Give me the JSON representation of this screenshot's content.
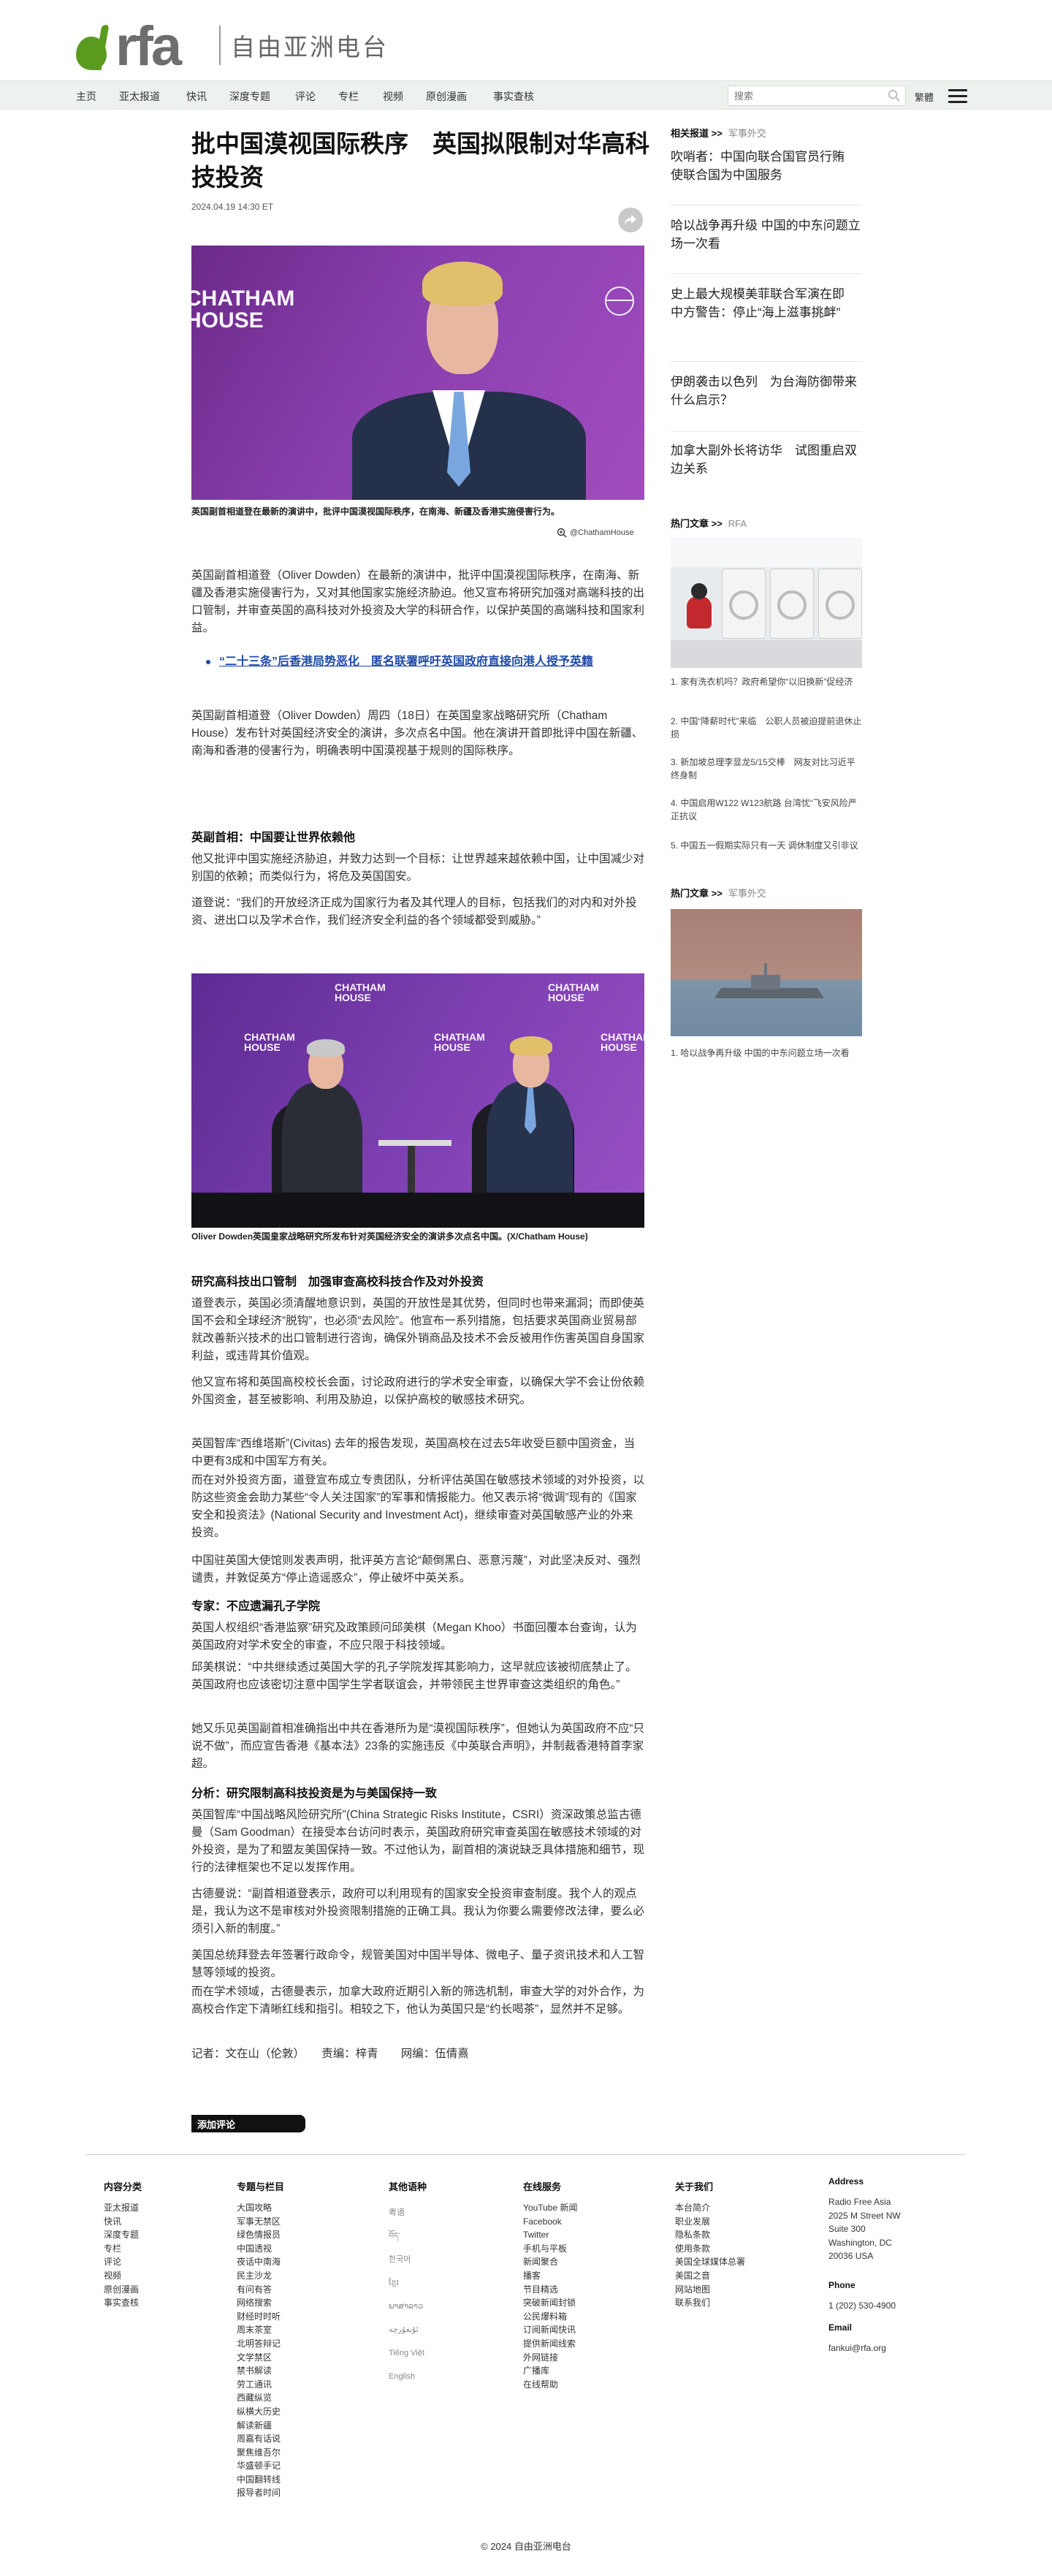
{
  "header": {
    "logo_text": "rfa",
    "logo_cn": "自由亚洲电台"
  },
  "nav": {
    "items": [
      "主页",
      "亚太报道",
      "快讯",
      "深度专题",
      "评论",
      "专栏",
      "视频",
      "原创漫画",
      "事实查核"
    ],
    "search_placeholder": "搜索",
    "lang": "繁體"
  },
  "article": {
    "title": "批中国漠视国际秩序　英国拟限制对华高科技投资",
    "date": "2024.04.19 14:30 ET",
    "photo1_caption": "英国副首相道登在最新的演讲中，批评中国漠视国际秩序，在南海、新疆及香港实施侵害行为。",
    "photo1_credit": "@ChathamHouse",
    "photo1_logo_text": "CHATHAM HOUSE",
    "p1": "英国副首相道登（Oliver Dowden）在最新的演讲中，批评中国漠视国际秩序，在南海、新疆及香港实施侵害行为，又对其他国家实施经济胁迫。他又宣布将研究加强对高端科技的出口管制，并审查英国的高科技对外投资及大学的科研合作，以保护英国的高端科技和国家利益。",
    "related_link": "“二十三条”后香港局势恶化　匿名联署呼吁英国政府直接向港人授予英籍",
    "p2": "英国副首相道登（Oliver Dowden）周四（18日）在英国皇家战略研究所（Chatham House）发布针对英国经济安全的演讲，多次点名中国。他在演讲开首即批评中国在新疆、南海和香港的侵害行为，明确表明中国漠视基于规则的国际秩序。",
    "h1": "英副首相：中国要让世界依赖他",
    "p3": "他又批评中国实施经济胁迫，并致力达到一个目标：让世界越来越依赖中国，让中国减少对别国的依赖；而类似行为，将危及英国国安。",
    "p4": "道登说：“我们的开放经济正成为国家行为者及其代理人的目标，包括我们的对内和对外投资、进出口以及学术合作，我们经济安全利益的各个领域都受到威胁。”",
    "photo2_caption": "Oliver Dowden英国皇家战略研究所发布针对英国经济安全的演讲多次点名中国。(X/Chatham House)",
    "photo2_logo_text": "CHATHAM HOUSE",
    "h2": "研究高科技出口管制　加强审查高校科技合作及对外投资",
    "p5": "道登表示，英国必须清醒地意识到，英国的开放性是其优势，但同时也带来漏洞；而即使英国不会和全球经济“脱钩”，也必须“去风险”。他宣布一系列措施，包括要求英国商业贸易部就改善新兴技术的出口管制进行咨询，确保外销商品及技术不会反被用作伤害英国自身国家利益，或违背其价值观。",
    "p6": "他又宣布将和英国高校校长会面，讨论政府进行的学术安全审查，以确保大学不会让份依赖外国资金，甚至被影响、利用及胁迫，以保护高校的敏感技术研究。",
    "p7": "英国智库“西维塔斯”(Civitas) 去年的报告发现，英国高校在过去5年收受巨额中国资金，当中更有3成和中国军方有关。",
    "p8": "而在对外投资方面，道登宣布成立专责团队，分析评估英国在敏感技术领域的对外投资，以防这些资金会助力某些“令人关注国家”的军事和情报能力。他又表示将“微调”现有的《国家安全和投资法》(National Security and Investment Act)，继续审查对英国敏感产业的外来投资。",
    "p9": "中国驻英国大使馆则发表声明，批评英方言论“颠倒黑白、恶意污蔑”，对此坚决反对、强烈谴责，并敦促英方“停止造谣惑众”，停止破坏中英关系。",
    "h3": "专家：不应遗漏孔子学院",
    "p10": "英国人权组织“香港监察”研究及政策顾问邱美棋（Megan Khoo）书面回覆本台查询，认为英国政府对学术安全的审查，不应只限于科技领域。",
    "p11": "邱美棋说：“中共继续透过英国大学的孔子学院发挥其影响力，这早就应该被彻底禁止了。英国政府也应该密切注意中国学生学者联谊会，并带领民主世界审查这类组织的角色。”",
    "p12": "她又乐见英国副首相准确指出中共在香港所为是“漠视国际秩序”，但她认为英国政府不应“只说不做”，而应宣告香港《基本法》23条的实施违反《中英联合声明》，并制裁香港特首李家超。",
    "h4": "分析：研究限制高科技投资是为与美国保持一致",
    "p13": "英国智库“中国战略风险研究所”(China Strategic Risks Institute，CSRI）资深政策总监古德曼（Sam Goodman）在接受本台访问时表示，英国政府研究审查英国在敏感技术领域的对外投资，是为了和盟友美国保持一致。不过他认为，副首相的演说缺乏具体措施和细节，现行的法律框架也不足以发挥作用。",
    "p14": "古德曼说：“副首相道登表示，政府可以利用现有的国家安全投资审查制度。我个人的观点是，我认为这不是审核对外投资限制措施的正确工具。我认为你要么需要修改法律，要么必须引入新的制度。”",
    "p15": "美国总统拜登去年签署行政命令，规管美国对中国半导体、微电子、量子资讯技术和人工智慧等领域的投资。",
    "p16": "而在学术领域，古德曼表示，加拿大政府近期引入新的筛选机制，审查大学的对外合作，为高校合作定下清晰红线和指引。相较之下，他认为英国只是“约长喝茶”，显然并不足够。",
    "byline": "记者：文在山（伦敦）　　责编：梓青　　网编：伍倩熹",
    "comment_button": "添加评论"
  },
  "sidebar": {
    "related_head": "相关报道 >>",
    "related_sub": "军事外交",
    "related_links": [
      "吹哨者：中国向联合国官员行贿　使联合国为中国服务",
      "哈以战争再升级 中国的中东问题立场一次看",
      "史上最大规模美菲联合军演在即　中方警告：停止“海上滋事挑衅”",
      "伊朗袭击以色列　为台海防御带来什么启示？",
      "加拿大副外长将访华　试图重启双边关系"
    ],
    "hot1_head": "热门文章 >>",
    "hot1_sub": "RFA",
    "hot1_list": [
      "1. 家有洗衣机吗？政府希望你“以旧换新”促经济",
      "2. 中国“降薪时代”来临　公职人员被迫提前退休止损",
      "3. 新加坡总理李显龙5/15交棒　网友对比习近平终身制",
      "4. 中国启用W122 W123航路 台湾忧“飞安风险严正抗议",
      "5. 中国五一假期实际只有一天 调休制度又引非议"
    ],
    "hot2_head": "热门文章 >>",
    "hot2_sub": "军事外交",
    "hot2_list": [
      "1. 哈以战争再升级 中国的中东问题立场一次看"
    ]
  },
  "footer": {
    "columns": [
      {
        "head": "内容分类",
        "items": [
          "亚太报道",
          "快讯",
          "深度专题",
          "专栏",
          "评论",
          "视频",
          "原创漫画",
          "事实查核"
        ]
      },
      {
        "head": "专题与栏目",
        "items": [
          "大国攻略",
          "军事无禁区",
          "绿色情报员",
          "中国透视",
          "夜话中南海",
          "民主沙龙",
          "有问有答",
          "网络搜索",
          "财经时时听",
          "周末茶室",
          "北明答辩记",
          "文学禁区",
          "禁书解读",
          "劳工通讯",
          "西藏纵览",
          "纵横大历史",
          "解读新疆",
          "周嘉有话说",
          "聚焦维吾尔",
          "华盛顿手记",
          "中国翻转线",
          "报导者时间"
        ]
      },
      {
        "head": "其他语种",
        "items": [
          "粤语",
          "བོད་",
          "한국어",
          "ខ្មែរ",
          "ພາສາລາວ",
          "ئۇيغۇرچە",
          "Tiếng Việt",
          "English"
        ]
      },
      {
        "head": "在线服务",
        "items": [
          "YouTube 新闻",
          "Facebook",
          "Twitter",
          "手机与平板",
          "新闻聚合",
          "播客",
          "节目精选",
          "突破新闻封锁",
          "公民爆料箱",
          "订阅新闻快讯",
          "提供新闻线索",
          "外网链接",
          "广播库",
          "在线帮助"
        ]
      },
      {
        "head": "关于我们",
        "items": [
          "本台简介",
          "职业发展",
          "隐私条款",
          "使用条款",
          "美国全球媒体总署",
          "美国之音",
          "网站地图",
          "联系我们"
        ]
      }
    ],
    "address_head": "Address",
    "address_lines": [
      "Radio Free Asia",
      "2025 M Street NW",
      "Suite 300",
      "Washington, DC",
      "20036 USA"
    ],
    "phone_head": "Phone",
    "phone": "1 (202) 530-4900",
    "email_head": "Email",
    "email": "fankui@rfa.org",
    "copyright": "© 2024 自由亚洲电台"
  }
}
